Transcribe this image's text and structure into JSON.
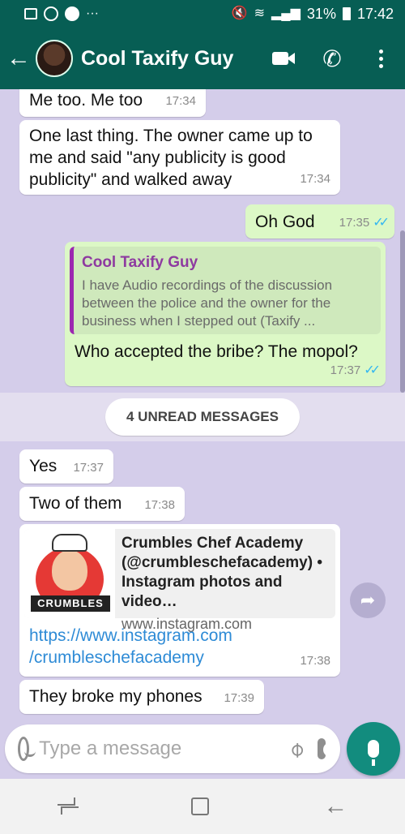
{
  "status_bar": {
    "battery": "31%",
    "time": "17:42",
    "dots": "···"
  },
  "header": {
    "contact_name": "Cool Taxify Guy"
  },
  "messages": [
    {
      "text": "Me too. Me too",
      "time": "17:34"
    },
    {
      "text": "One last thing. The owner came up to me and said \"any publicity is good publicity\" and walked away",
      "time": "17:34"
    },
    {
      "text": "Oh God",
      "time": "17:35"
    },
    {
      "quote_author": "Cool Taxify Guy",
      "quote_text": "I have Audio recordings of the discussion between the police and the owner for the business when I stepped out (Taxify ...",
      "text": "Who accepted the bribe? The mopol?",
      "time": "17:37"
    }
  ],
  "unread_label": "4 UNREAD MESSAGES",
  "unread_messages": [
    {
      "text": "Yes",
      "time": "17:37"
    },
    {
      "text": "Two of them",
      "time": "17:38"
    },
    {
      "link_title": "Crumbles Chef Academy (@crumbleschefacademy) • Instagram photos and video…",
      "link_domain": "www.instagram.com",
      "thumb_label": "CRUMBLES",
      "url_line1": "https://www.instagram.com",
      "url_line2": "/crumbleschefacademy",
      "time": "17:38"
    },
    {
      "text": "They broke my phones",
      "time": "17:39"
    }
  ],
  "composer": {
    "placeholder": "Type a message"
  },
  "colors": {
    "header": "#075e54",
    "outgoing": "#dcf8c6",
    "incoming": "#ffffff",
    "mic": "#128c7e",
    "wallpaper": "#d4cdea"
  }
}
